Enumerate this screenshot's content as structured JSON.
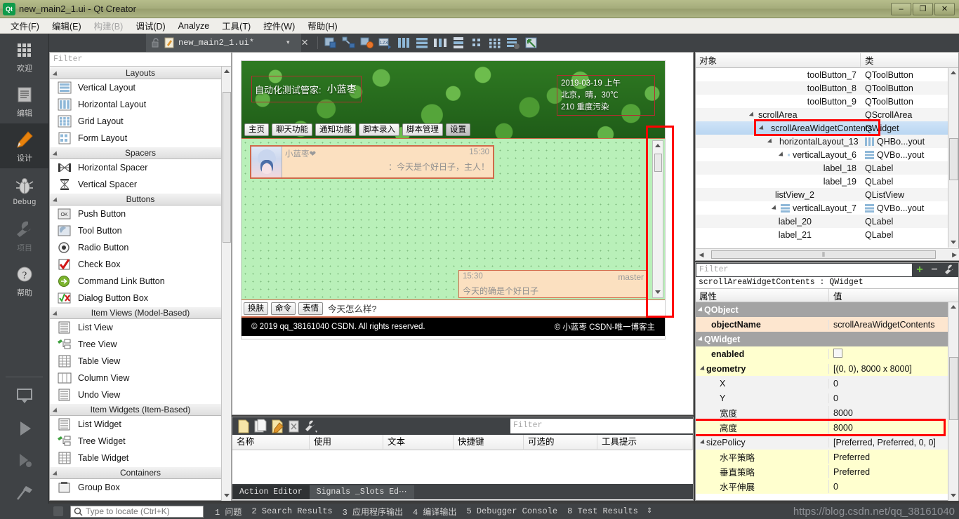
{
  "window": {
    "title": "new_main2_1.ui - Qt Creator",
    "app_icon": "qt-logo-icon",
    "minimize": "–",
    "maximize": "❐",
    "close": "✕"
  },
  "menubar": {
    "items": [
      {
        "label": "文件(F)",
        "disabled": false
      },
      {
        "label": "编辑(E)",
        "disabled": false
      },
      {
        "label": "构建(B)",
        "disabled": true
      },
      {
        "label": "调试(D)",
        "disabled": false
      },
      {
        "label": "Analyze",
        "disabled": false
      },
      {
        "label": "工具(T)",
        "disabled": false
      },
      {
        "label": "控件(W)",
        "disabled": false
      },
      {
        "label": "帮助(H)",
        "disabled": false
      }
    ]
  },
  "modebar": {
    "items": [
      {
        "label": "欢迎",
        "icon": "grid-icon",
        "active": false,
        "disabled": false
      },
      {
        "label": "编辑",
        "icon": "document-lines-icon",
        "active": false,
        "disabled": false
      },
      {
        "label": "设计",
        "icon": "pencil-icon",
        "active": true,
        "disabled": false
      },
      {
        "label": "Debug",
        "icon": "bug-icon",
        "active": false,
        "disabled": false
      },
      {
        "label": "项目",
        "icon": "wrench-icon",
        "active": false,
        "disabled": true
      },
      {
        "label": "帮助",
        "icon": "question-circle-icon",
        "active": false,
        "disabled": false
      }
    ],
    "bottom_icons": [
      "monitor-icon",
      "run-play-icon",
      "debug-play-icon",
      "hammer-icon"
    ]
  },
  "widget_box": {
    "filter_placeholder": "Filter",
    "groups": [
      {
        "title": "Layouts",
        "items": [
          {
            "label": "Vertical Layout",
            "icon": "vertical-layout-icon"
          },
          {
            "label": "Horizontal Layout",
            "icon": "horizontal-layout-icon"
          },
          {
            "label": "Grid Layout",
            "icon": "grid-layout-icon"
          },
          {
            "label": "Form Layout",
            "icon": "form-layout-icon"
          }
        ]
      },
      {
        "title": "Spacers",
        "items": [
          {
            "label": "Horizontal Spacer",
            "icon": "horizontal-spacer-icon"
          },
          {
            "label": "Vertical Spacer",
            "icon": "vertical-spacer-icon"
          }
        ]
      },
      {
        "title": "Buttons",
        "items": [
          {
            "label": "Push Button",
            "icon": "push-button-icon"
          },
          {
            "label": "Tool Button",
            "icon": "tool-button-icon"
          },
          {
            "label": "Radio Button",
            "icon": "radio-button-icon"
          },
          {
            "label": "Check Box",
            "icon": "check-box-icon"
          },
          {
            "label": "Command Link Button",
            "icon": "command-link-icon"
          },
          {
            "label": "Dialog Button Box",
            "icon": "dialog-button-box-icon"
          }
        ]
      },
      {
        "title": "Item Views (Model-Based)",
        "items": [
          {
            "label": "List View",
            "icon": "list-view-icon"
          },
          {
            "label": "Tree View",
            "icon": "tree-view-icon"
          },
          {
            "label": "Table View",
            "icon": "table-view-icon"
          },
          {
            "label": "Column View",
            "icon": "column-view-icon"
          },
          {
            "label": "Undo View",
            "icon": "undo-view-icon"
          }
        ]
      },
      {
        "title": "Item Widgets (Item-Based)",
        "items": [
          {
            "label": "List Widget",
            "icon": "list-widget-icon"
          },
          {
            "label": "Tree Widget",
            "icon": "tree-widget-icon"
          },
          {
            "label": "Table Widget",
            "icon": "table-widget-icon"
          }
        ]
      },
      {
        "title": "Containers",
        "items": [
          {
            "label": "Group Box",
            "icon": "group-box-icon"
          }
        ]
      }
    ]
  },
  "editor_toolbar": {
    "file_tab": "new_main2_1.ui*",
    "dropdown_caret": "▾",
    "close_label": "✕",
    "tools": [
      "edit-widgets-icon",
      "edit-signals-slots-icon",
      "edit-buddies-icon",
      "edit-tab-order-icon",
      "layout-horizontally-icon",
      "layout-vertically-icon",
      "layout-splitter-h-icon",
      "layout-splitter-v-icon",
      "layout-form-icon",
      "layout-grid-icon",
      "break-layout-icon",
      "adjust-size-icon"
    ]
  },
  "form": {
    "header": {
      "title_prefix": "自动化测试管家:",
      "title_name": "小蓝枣",
      "weather_lines": [
        "2019-03-19 上午",
        "北京，晴，30℃",
        "210 重度污染"
      ],
      "tabs": [
        {
          "label": "主页",
          "selected": false
        },
        {
          "label": "聊天功能",
          "selected": false
        },
        {
          "label": "通知功能",
          "selected": false
        },
        {
          "label": "脚本录入",
          "selected": false
        },
        {
          "label": "脚本管理",
          "selected": false
        },
        {
          "label": "设置",
          "selected": true
        }
      ]
    },
    "messages": {
      "incoming": {
        "name": "小蓝枣❤",
        "time": "15:30",
        "text": "：今天是个好日子，主人！",
        "avatar": "anime-avatar"
      },
      "outgoing": {
        "time": "15:30",
        "name": "master",
        "text": "今天的确是个好日子"
      }
    },
    "input_row": {
      "buttons": [
        "换肤",
        "命令",
        "表情"
      ],
      "input_value": "今天怎么样?"
    },
    "footer": {
      "left": "© 2019 qq_38161040 CSDN. All rights reserved.",
      "right": "© 小蓝枣 CSDN-唯一博客主"
    }
  },
  "object_inspector": {
    "columns": [
      "对象",
      "类"
    ],
    "rows": [
      {
        "name": "toolButton_7",
        "class": "QToolButton",
        "indent": 4,
        "expander": false,
        "icon": null,
        "class_icon": null,
        "selected": false
      },
      {
        "name": "toolButton_8",
        "class": "QToolButton",
        "indent": 4,
        "expander": false,
        "icon": null,
        "class_icon": null,
        "selected": false
      },
      {
        "name": "toolButton_9",
        "class": "QToolButton",
        "indent": 4,
        "expander": false,
        "icon": null,
        "class_icon": null,
        "selected": false
      },
      {
        "name": "scrollArea",
        "class": "QScrollArea",
        "indent": 3,
        "expander": true,
        "icon": null,
        "class_icon": null,
        "selected": false
      },
      {
        "name": "scrollAreaWidgetContents",
        "class": "QWidget",
        "indent": 4,
        "expander": true,
        "icon": "widget-icon",
        "class_icon": null,
        "selected": true
      },
      {
        "name": "horizontalLayout_13",
        "class": "QHBo...yout",
        "indent": 5,
        "expander": true,
        "icon": "hlayout-icon",
        "class_icon": "hlayout-icon",
        "selected": false
      },
      {
        "name": "verticalLayout_6",
        "class": "QVBo...yout",
        "indent": 6,
        "expander": true,
        "icon": "vlayout-icon",
        "class_icon": "vlayout-icon",
        "selected": false
      },
      {
        "name": "label_18",
        "class": "QLabel",
        "indent": 7,
        "expander": false,
        "icon": null,
        "class_icon": null,
        "selected": false
      },
      {
        "name": "label_19",
        "class": "QLabel",
        "indent": 7,
        "expander": false,
        "icon": null,
        "class_icon": null,
        "selected": false
      },
      {
        "name": "listView_2",
        "class": "QListView",
        "indent": 6,
        "expander": false,
        "icon": null,
        "class_icon": null,
        "selected": false
      },
      {
        "name": "verticalLayout_7",
        "class": "QVBo...yout",
        "indent": 6,
        "expander": true,
        "icon": "vlayout-icon",
        "class_icon": "vlayout-icon",
        "selected": false
      },
      {
        "name": "label_20",
        "class": "QLabel",
        "indent": 6,
        "expander": false,
        "icon": null,
        "class_icon": null,
        "selected": false
      },
      {
        "name": "label_21",
        "class": "QLabel",
        "indent": 6,
        "expander": false,
        "icon": null,
        "class_icon": null,
        "selected": false
      }
    ]
  },
  "property_editor": {
    "filter_placeholder": "Filter",
    "add_label": "+",
    "remove_label": "−",
    "config_icon": "wrench-icon",
    "object_header": "scrollAreaWidgetContents : QWidget",
    "columns": [
      "属性",
      "值"
    ],
    "rows": [
      {
        "key": "QObject",
        "value": "",
        "type": "group",
        "indent": 0,
        "expander": true
      },
      {
        "key": "objectName",
        "value": "scrollAreaWidgetContents",
        "type": "orange",
        "indent": 1,
        "expander": false
      },
      {
        "key": "QWidget",
        "value": "",
        "type": "group",
        "indent": 0,
        "expander": true
      },
      {
        "key": "enabled",
        "value": "",
        "type": "yellow",
        "indent": 1,
        "expander": false,
        "checkbox": true
      },
      {
        "key": "geometry",
        "value": "[(0, 0), 8000 x 8000]",
        "type": "yellow",
        "indent": 0,
        "expander": true
      },
      {
        "key": "X",
        "value": "0",
        "type": "white",
        "indent": 2,
        "expander": false
      },
      {
        "key": "Y",
        "value": "0",
        "type": "white",
        "indent": 2,
        "expander": false
      },
      {
        "key": "宽度",
        "value": "8000",
        "type": "white",
        "indent": 2,
        "expander": false
      },
      {
        "key": "高度",
        "value": "8000",
        "type": "yellow",
        "indent": 2,
        "expander": false,
        "highlight": true
      },
      {
        "key": "sizePolicy",
        "value": "[Preferred, Preferred, 0, 0]",
        "type": "white",
        "indent": 0,
        "expander": true
      },
      {
        "key": "水平策略",
        "value": "Preferred",
        "type": "yellow",
        "indent": 2,
        "expander": false
      },
      {
        "key": "垂直策略",
        "value": "Preferred",
        "type": "yellow",
        "indent": 2,
        "expander": false
      },
      {
        "key": "水平伸展",
        "value": "0",
        "type": "yellow",
        "indent": 2,
        "expander": false
      }
    ]
  },
  "action_editor": {
    "toolbar_icons": [
      "new-action-icon",
      "copy-action-icon",
      "edit-action-icon",
      "delete-action-icon",
      "view-options-icon"
    ],
    "filter_placeholder": "Filter",
    "columns": [
      "名称",
      "使用",
      "文本",
      "快捷键",
      "可选的",
      "工具提示"
    ],
    "rows": [],
    "tabs": [
      {
        "label": "Action Editor",
        "selected": true
      },
      {
        "label": "Signals _Slots Ed⋯",
        "selected": false
      }
    ]
  },
  "statusbar": {
    "locate_placeholder": "Type to locate (Ctrl+K)",
    "search_icon": "search-icon",
    "panes": [
      "1 问题",
      "2 Search Results",
      "3 应用程序输出",
      "4 编译输出",
      "5 Debugger Console",
      "8 Test Results"
    ],
    "updown": "⇕",
    "watermark": "https://blog.csdn.net/qq_38161040"
  },
  "colors": {
    "dark_chrome": "#3f4245",
    "selection_blue": "#b9d6f2",
    "highlight_red": "#ff0000",
    "accent_green": "#6ec440"
  }
}
